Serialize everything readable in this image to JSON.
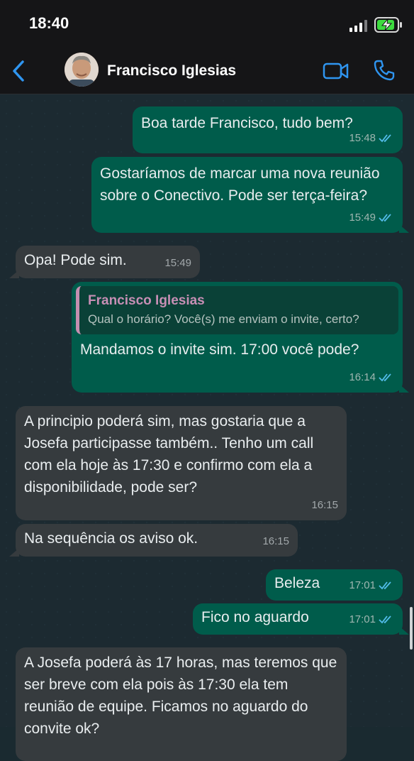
{
  "status_bar": {
    "time": "18:40"
  },
  "header": {
    "contact_name": "Francisco Iglesias"
  },
  "messages": [
    {
      "text": "Boa tarde Francisco, tudo bem?",
      "time": "15:48"
    },
    {
      "text": "Gostaríamos de marcar uma nova reunião sobre o Conectivo. Pode ser terça-feira?",
      "time": "15:49"
    },
    {
      "text": "Opa! Pode sim.",
      "time": "15:49"
    },
    {
      "quote_name": "Francisco Iglesias",
      "quote_text": "Qual o horário? Você(s) me enviam o invite, certo?",
      "text": "Mandamos o invite sim. 17:00 você pode?",
      "time": "16:14"
    },
    {
      "text": "A principio poderá sim, mas gostaria que a Josefa participasse também.. Tenho um call com ela hoje às 17:30 e confirmo com ela a disponibilidade, pode ser?",
      "time": "16:15"
    },
    {
      "text": "Na sequência os aviso ok.",
      "time": "16:15"
    },
    {
      "text": "Beleza",
      "time": "17:01"
    },
    {
      "text": "Fico no aguardo",
      "time": "17:01"
    },
    {
      "text": "A Josefa poderá às 17 horas, mas teremos que ser breve com ela pois às 17:30 ela tem reunião de equipe. Ficamos no aguardo do convite ok?",
      "time": ""
    }
  ]
}
